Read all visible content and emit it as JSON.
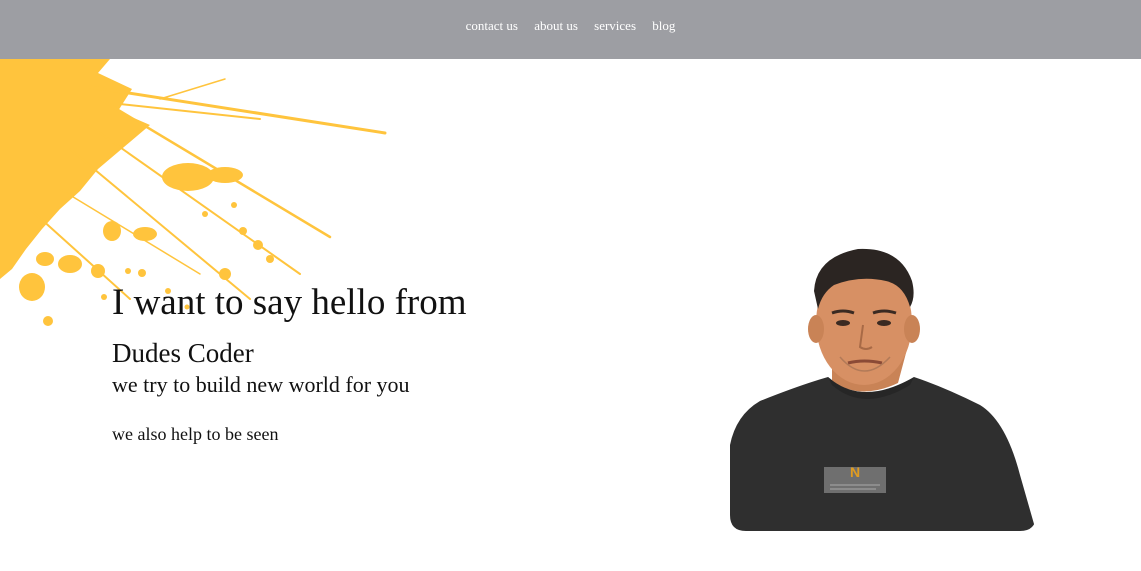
{
  "nav": {
    "items": [
      {
        "label": "contact us"
      },
      {
        "label": "about us"
      },
      {
        "label": "services"
      },
      {
        "label": "blog"
      }
    ]
  },
  "hero": {
    "headline": "I want to say hello from",
    "brand": "Dudes Coder",
    "tagline": "we try to build new world for you",
    "subtext": "we also help to be seen"
  },
  "colors": {
    "navbar": "#9d9ea3",
    "accent_splash": "#ffc43d",
    "text": "#111111",
    "shirt": "#2f2f2f"
  },
  "images": {
    "splash": "yellow-paint-splash",
    "portrait": "man-in-dark-tshirt-portrait"
  }
}
